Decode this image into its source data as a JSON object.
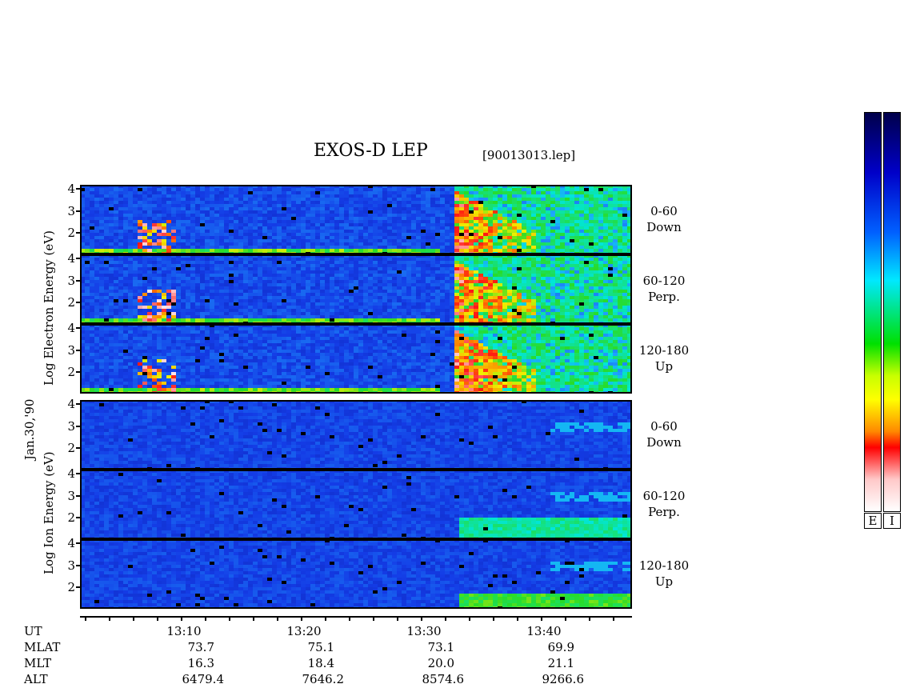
{
  "title": "EXOS-D LEP",
  "file_label": "[90013013.lep]",
  "date_label": "Jan.30,'90",
  "electron_axis_label": "Log Electron Energy (eV)",
  "ion_axis_label": "Log Ion Energy (eV)",
  "chart_data": {
    "type": "heatmap",
    "y_ticks": [
      "4",
      "3",
      "2"
    ],
    "panels": [
      {
        "species": "electron",
        "pitch": "0-60",
        "direction": "Down"
      },
      {
        "species": "electron",
        "pitch": "60-120",
        "direction": "Perp."
      },
      {
        "species": "electron",
        "pitch": "120-180",
        "direction": "Up"
      },
      {
        "species": "ion",
        "pitch": "0-60",
        "direction": "Down"
      },
      {
        "species": "ion",
        "pitch": "60-120",
        "direction": "Perp."
      },
      {
        "species": "ion",
        "pitch": "120-180",
        "direction": "Up"
      }
    ],
    "ylim": [
      1,
      4.2
    ],
    "colorbar_labels": [
      "E",
      "I"
    ],
    "colorbar_colors": [
      "#ffffff",
      "#ff0000",
      "#ff8800",
      "#ffff00",
      "#00dd00",
      "#00ffff",
      "#0088ff",
      "#0000cc",
      "#000066"
    ]
  },
  "ephemeris": {
    "rows": [
      {
        "label": "UT",
        "values": [
          "13:10",
          "13:20",
          "13:30",
          "13:40"
        ]
      },
      {
        "label": "MLAT",
        "values": [
          "73.7",
          "75.1",
          "73.1",
          "69.9"
        ]
      },
      {
        "label": "MLT",
        "values": [
          "16.3",
          "18.4",
          "20.0",
          "21.1"
        ]
      },
      {
        "label": "ALT",
        "values": [
          "6479.4",
          "7646.2",
          "8574.6",
          "9266.6"
        ]
      }
    ]
  }
}
